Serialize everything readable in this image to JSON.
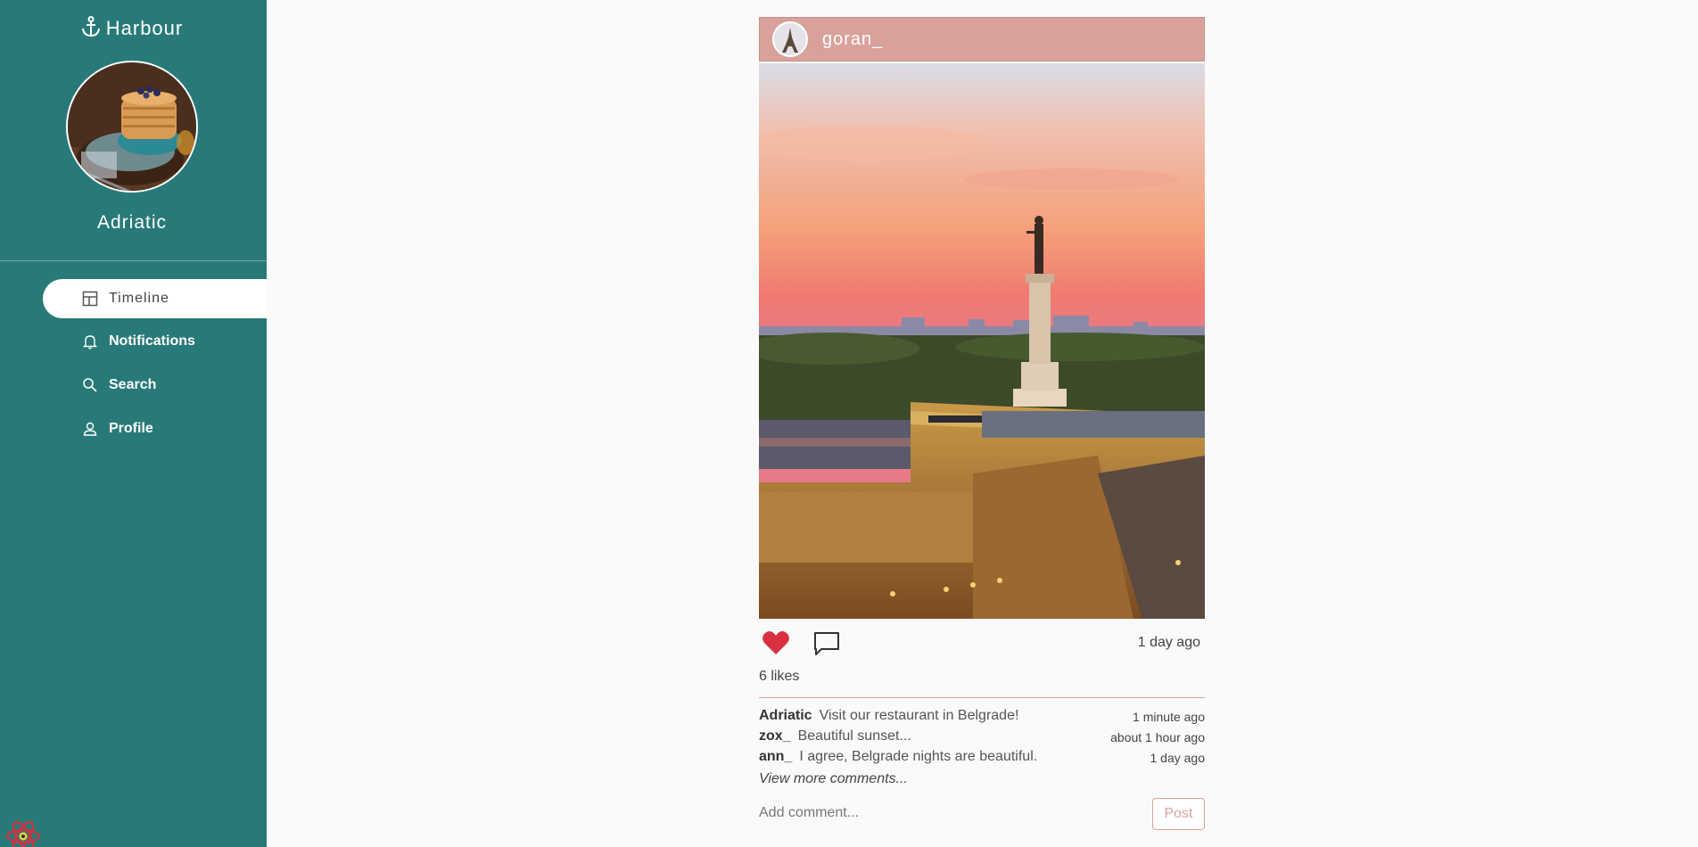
{
  "sidebar": {
    "brand": "Harbour",
    "username": "Adriatic",
    "nav": [
      {
        "label": "Timeline",
        "icon": "layout-icon",
        "active": true
      },
      {
        "label": "Notifications",
        "icon": "bell-icon",
        "active": false
      },
      {
        "label": "Search",
        "icon": "search-icon",
        "active": false
      },
      {
        "label": "Profile",
        "icon": "user-icon",
        "active": false
      }
    ]
  },
  "post": {
    "author": "goran_",
    "time": "1 day ago",
    "likes": "6 likes",
    "liked": true,
    "comments": [
      {
        "user": "Adriatic",
        "text": "Visit our restaurant in Belgrade!",
        "time": "1 minute ago"
      },
      {
        "user": "zox_",
        "text": "Beautiful sunset...",
        "time": "about 1 hour ago"
      },
      {
        "user": "ann_",
        "text": "I agree, Belgrade nights are beautiful.",
        "time": "1 day ago"
      }
    ],
    "view_more": "View more comments...",
    "add_comment_placeholder": "Add comment...",
    "post_button": "Post"
  },
  "colors": {
    "sidebar": "#287a78",
    "accent": "#d9a19b",
    "like": "#d8303e"
  }
}
